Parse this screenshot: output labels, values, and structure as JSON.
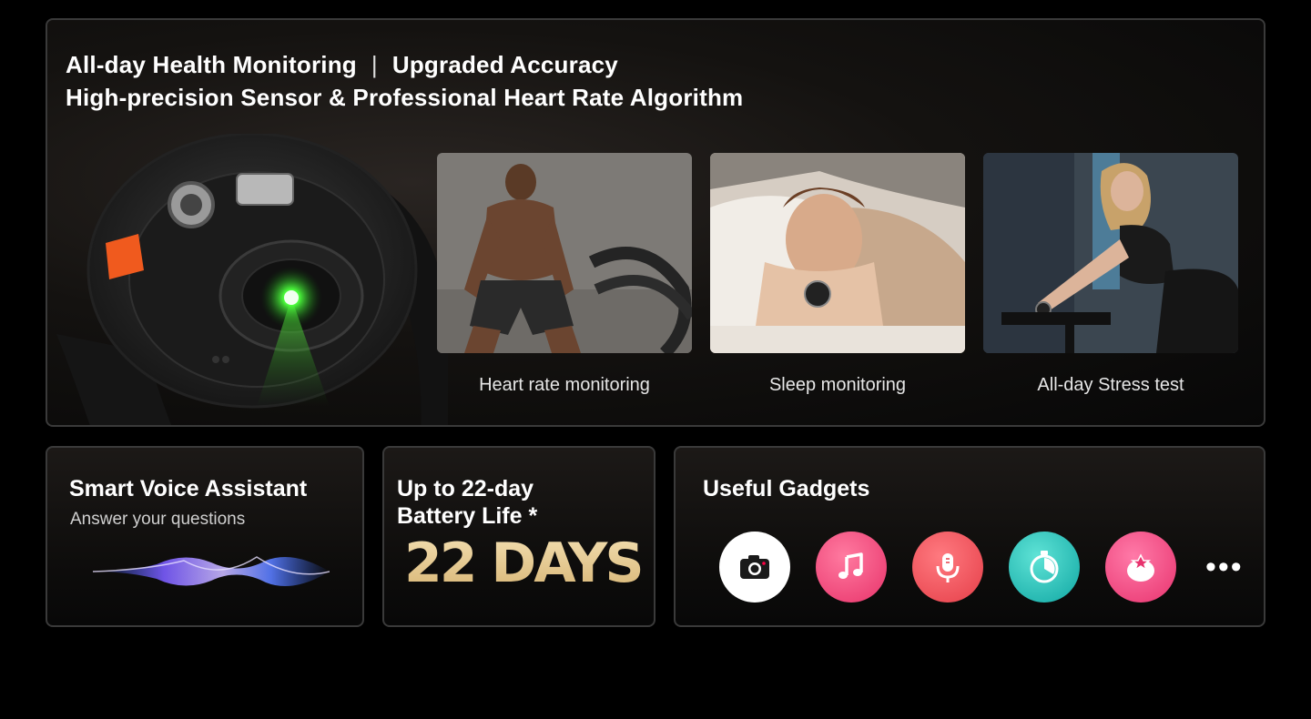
{
  "header": {
    "line1_left": "All-day Health Monitoring",
    "separator": "|",
    "line1_right": "Upgraded Accuracy",
    "line2": "High-precision Sensor & Professional Heart Rate Algorithm"
  },
  "features": [
    {
      "caption": "Heart rate monitoring",
      "image": "man-battle-ropes-photo"
    },
    {
      "caption": "Sleep monitoring",
      "image": "woman-sleeping-photo"
    },
    {
      "caption": "All-day Stress test",
      "image": "woman-exercise-bike-photo"
    }
  ],
  "voice": {
    "title": "Smart Voice Assistant",
    "subtitle": "Answer your questions"
  },
  "battery": {
    "title_line1": "Up to 22-day",
    "title_line2": "Battery Life *",
    "big": "22 DAYS"
  },
  "gadgets": {
    "title": "Useful Gadgets",
    "icons": [
      {
        "name": "camera-icon",
        "bg": "#ffffff"
      },
      {
        "name": "music-icon",
        "bg": "#f2447a"
      },
      {
        "name": "voice-recorder-icon",
        "bg": "#ee4d57"
      },
      {
        "name": "stopwatch-icon",
        "bg": "#1fb8b3"
      },
      {
        "name": "tomato-timer-icon",
        "bg": "#f2447a"
      }
    ],
    "more": "•••"
  },
  "colors": {
    "accent_gold": "#e8cf9b",
    "sensor_green": "#3dff4a",
    "crown_orange": "#f05a1e"
  }
}
